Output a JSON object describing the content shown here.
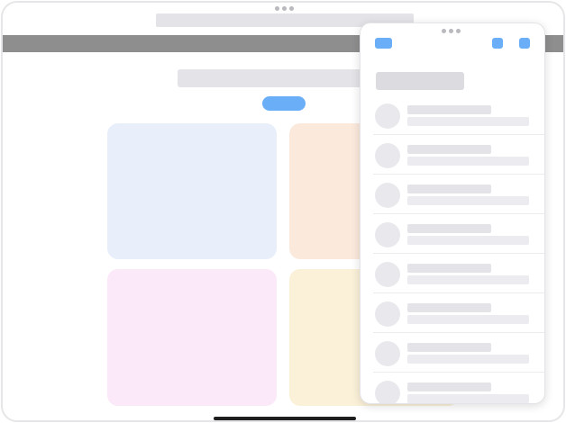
{
  "colors": {
    "accent": "#6aaef7",
    "tile_blue": "#e8effb",
    "tile_orange": "#fbe9dc",
    "tile_pink": "#fbe8f8",
    "tile_yellow": "#fbf1d9",
    "placeholder": "#e4e4e8",
    "tab_bar": "#8e8e8e"
  },
  "panel": {
    "list": {
      "item_count": 8
    }
  }
}
